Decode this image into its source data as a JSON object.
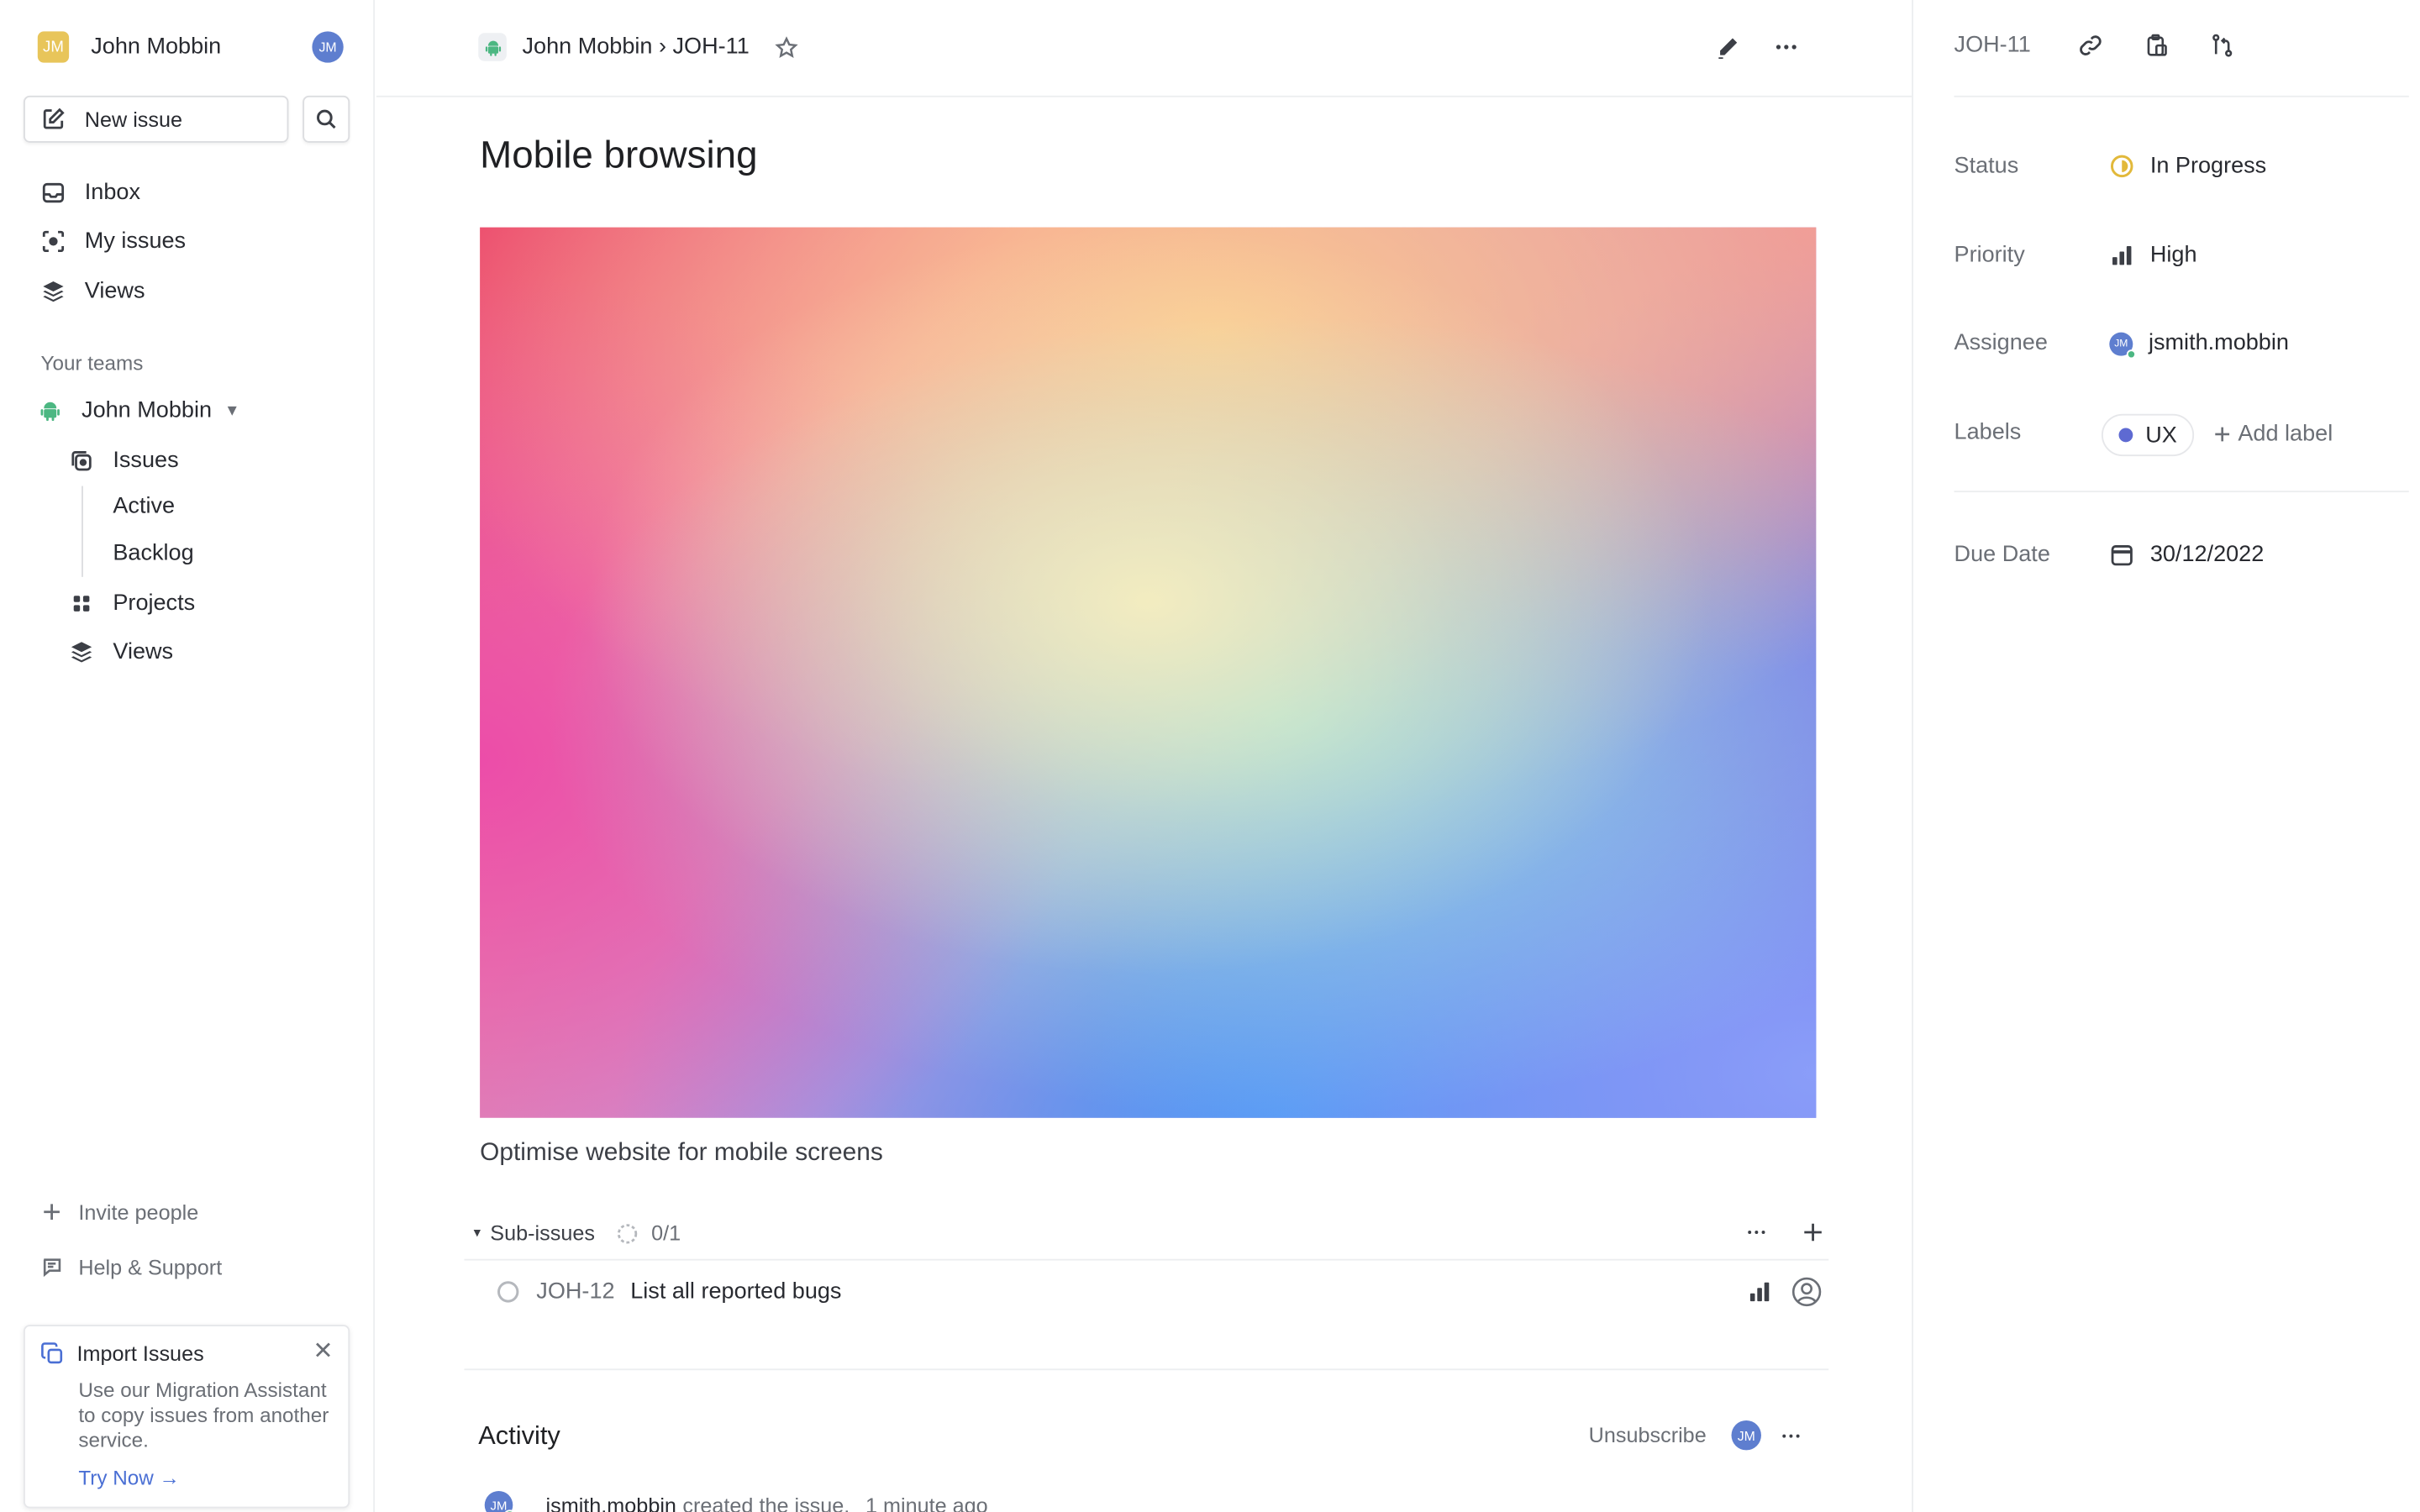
{
  "workspace": {
    "name": "John Mobbin",
    "logo_text": "JM",
    "avatar_initials": "JM"
  },
  "sidebar": {
    "new_issue_label": "New issue",
    "nav": [
      {
        "label": "Inbox",
        "icon": "inbox-icon"
      },
      {
        "label": "My issues",
        "icon": "target-icon"
      },
      {
        "label": "Views",
        "icon": "layers-icon"
      }
    ],
    "teams_heading": "Your teams",
    "team": {
      "name": "John Mobbin",
      "caret": "▼",
      "items": [
        {
          "label": "Issues",
          "icon": "issues-icon"
        },
        {
          "label": "Active"
        },
        {
          "label": "Backlog"
        },
        {
          "label": "Projects",
          "icon": "grid-icon"
        },
        {
          "label": "Views",
          "icon": "layers-icon"
        }
      ]
    },
    "footer": [
      {
        "label": "Invite people",
        "icon": "plus-icon"
      },
      {
        "label": "Help & Support",
        "icon": "chat-icon"
      }
    ],
    "import_card": {
      "title": "Import Issues",
      "description": "Use our Migration Assistant to copy issues from another service.",
      "cta": "Try Now →"
    }
  },
  "topbar": {
    "breadcrumb": "John Mobbin › JOH-11"
  },
  "issue": {
    "title": "Mobile browsing",
    "description": "Optimise website for mobile screens",
    "sub_issues": {
      "heading": "Sub-issues",
      "toggle": "▾",
      "progress": "0/1",
      "items": [
        {
          "id": "JOH-12",
          "title": "List all reported bugs"
        }
      ]
    },
    "activity": {
      "heading": "Activity",
      "unsubscribe": "Unsubscribe",
      "avatar_initials": "JM",
      "entries": [
        {
          "avatar_initials": "JM",
          "user": "jsmith.mobbin",
          "action": "created the issue.",
          "time": "1 minute ago"
        }
      ]
    }
  },
  "panel": {
    "issue_id": "JOH-11",
    "status": {
      "label": "Status",
      "value": "In Progress",
      "color": "#e2b93b"
    },
    "priority": {
      "label": "Priority",
      "value": "High"
    },
    "assignee": {
      "label": "Assignee",
      "value": "jsmith.mobbin",
      "avatar_initials": "JM"
    },
    "labels": {
      "label": "Labels",
      "chips": [
        {
          "name": "UX",
          "color": "#5e6ad2"
        }
      ],
      "add": "Add label"
    },
    "due_date": {
      "label": "Due Date",
      "value": "30/12/2022"
    }
  },
  "colors": {
    "accent": "#5e6ad2",
    "link": "#4a6fd4",
    "avatar": "#5e7ecf",
    "online": "#4cb782"
  }
}
